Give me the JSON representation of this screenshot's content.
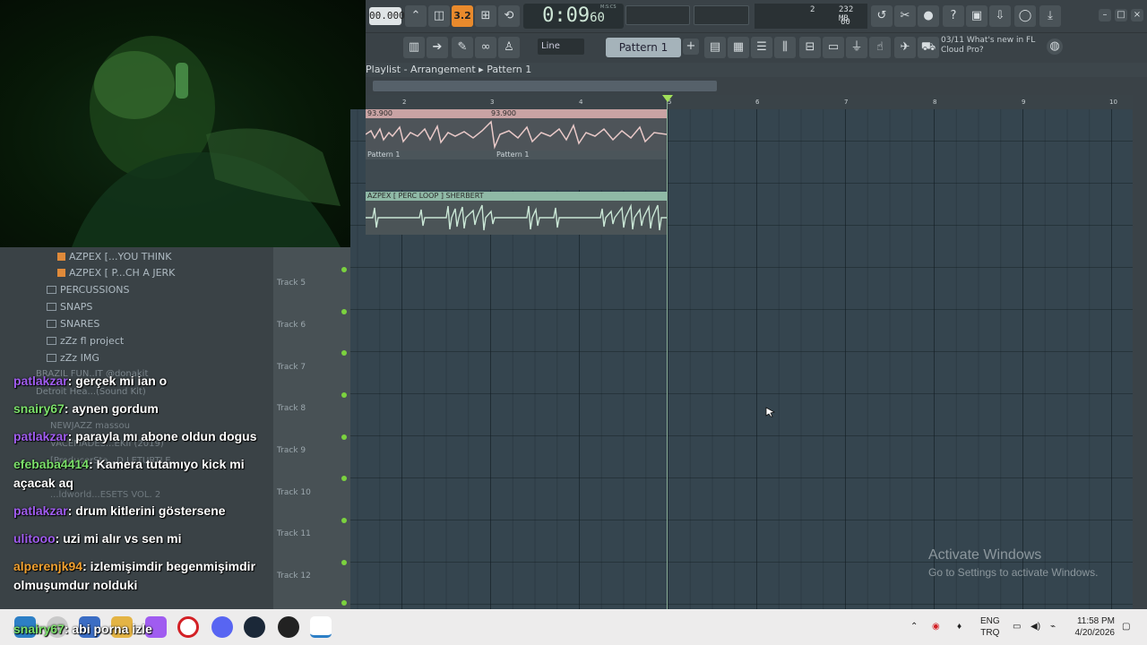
{
  "toolbar": {
    "tempo": "00.000",
    "pattern_step": "3.2",
    "time_main": "0:09",
    "time_sub": "60",
    "time_units": "M:S:CS",
    "cpu_value": "2",
    "mem": "232 MB",
    "poly": "60",
    "snap_mode": "Line",
    "pattern_label": "Pattern 1",
    "news_count": "03/11",
    "news_text": "What's new in FL Cloud Pro?"
  },
  "playlist": {
    "title": "Playlist - Arrangement",
    "breadcrumb_sep": "▸",
    "pattern": "Pattern 1",
    "ruler_numbers": [
      "2",
      "3",
      "4",
      "5",
      "6",
      "7",
      "8",
      "9",
      "10"
    ],
    "clips": {
      "audio1_label_a": "93.900",
      "audio1_label_b": "93.900",
      "pattern_a": "Pattern 1",
      "pattern_b": "Pattern 1",
      "perc_loop": "AZPEX [ PERC LOOP ] SHERBERT"
    },
    "tracks": [
      "Track 5",
      "Track 6",
      "Track 7",
      "Track 8",
      "Track 9",
      "Track 10",
      "Track 11",
      "Track 12"
    ]
  },
  "browser": {
    "files": [
      "AZPEX [...YOU THINK",
      "AZPEX [ P...CH A JERK"
    ],
    "folders": [
      "PERCUSSIONS",
      "SNAPS",
      "SNARES",
      "zZz fl project",
      "zZz IMG"
    ],
    "faded": [
      "BRAZIL FUN..IT @donakit",
      "Detroit Hea...(Sound Kit)",
      "NEWJAZZ massou",
      "VACEMADES...EKII (2019)",
      "[ProducerSta...D.LETURTLE",
      "...ldworld...ESETS VOL. 2"
    ]
  },
  "chat": [
    {
      "user": "patlakzar",
      "color": "#a05cf0",
      "text": "gerçek mi ian o"
    },
    {
      "user": "snairy67",
      "color": "#7be06a",
      "text": "aynen gordum"
    },
    {
      "user": "patlakzar",
      "color": "#a05cf0",
      "text": "parayla mı abone oldun dogus"
    },
    {
      "user": "efebaba4414",
      "color": "#7be06a",
      "text": "Kamera tutamıyo kick mi açacak aq"
    },
    {
      "user": "patlakzar",
      "color": "#a05cf0",
      "text": "drum kitlerini göstersene"
    },
    {
      "user": "ulitooo",
      "color": "#a05cf0",
      "text": "uzi mi alır vs sen mi"
    },
    {
      "user": "alperenjk94",
      "color": "#f0a030",
      "text": "izlemişimdir begenmişimdir olmuşumdur nolduki"
    },
    {
      "user": "snairy67",
      "color": "#7be06a",
      "text": "abi porna izle"
    }
  ],
  "watermark": {
    "title": "Activate Windows",
    "subtitle": "Go to Settings to activate Windows."
  },
  "taskbar": {
    "lang1": "ENG",
    "lang2": "TRQ",
    "time": "11:58 PM",
    "date": "4/20/2026"
  },
  "colors": {
    "grid_bg": "#35454f",
    "audio_clip_head": "#c9a3a4",
    "audio_clip_body": "#4f5358",
    "perc_clip_head": "#8fb9a6",
    "accent_orange": "#e98a2c",
    "track_dot": "#7bd23f"
  }
}
